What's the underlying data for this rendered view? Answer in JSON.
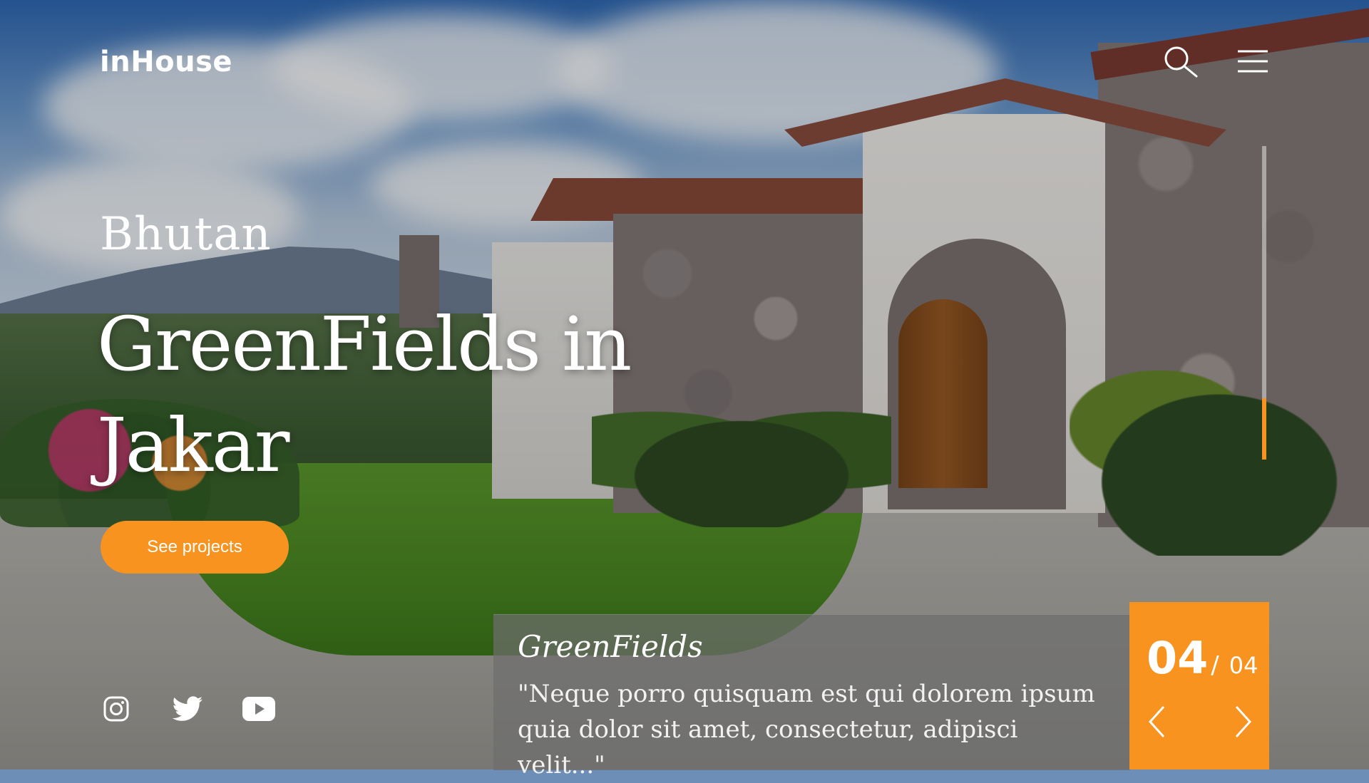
{
  "brand": {
    "logo": "inHouse"
  },
  "header": {
    "search_icon": "search-icon",
    "menu_icon": "hamburger-menu-icon"
  },
  "hero": {
    "location": "Bhutan",
    "title_line1": "GreenFields in",
    "title_line2": "Jakar",
    "cta_label": "See projects"
  },
  "socials": [
    {
      "icon": "instagram-icon"
    },
    {
      "icon": "twitter-icon"
    },
    {
      "icon": "youtube-icon"
    }
  ],
  "card": {
    "title": "GreenFields",
    "quote": "\"Neque porro quisquam est qui dolorem ipsum quia dolor sit amet, consectetur, adipisci velit...\""
  },
  "pager": {
    "current": "04",
    "separator": "/",
    "total": "04",
    "prev_icon": "chevron-left-icon",
    "next_icon": "chevron-right-icon"
  },
  "slides": {
    "count": 4,
    "active_index": 4
  },
  "colors": {
    "accent": "#f7931e",
    "text": "#ffffff"
  }
}
